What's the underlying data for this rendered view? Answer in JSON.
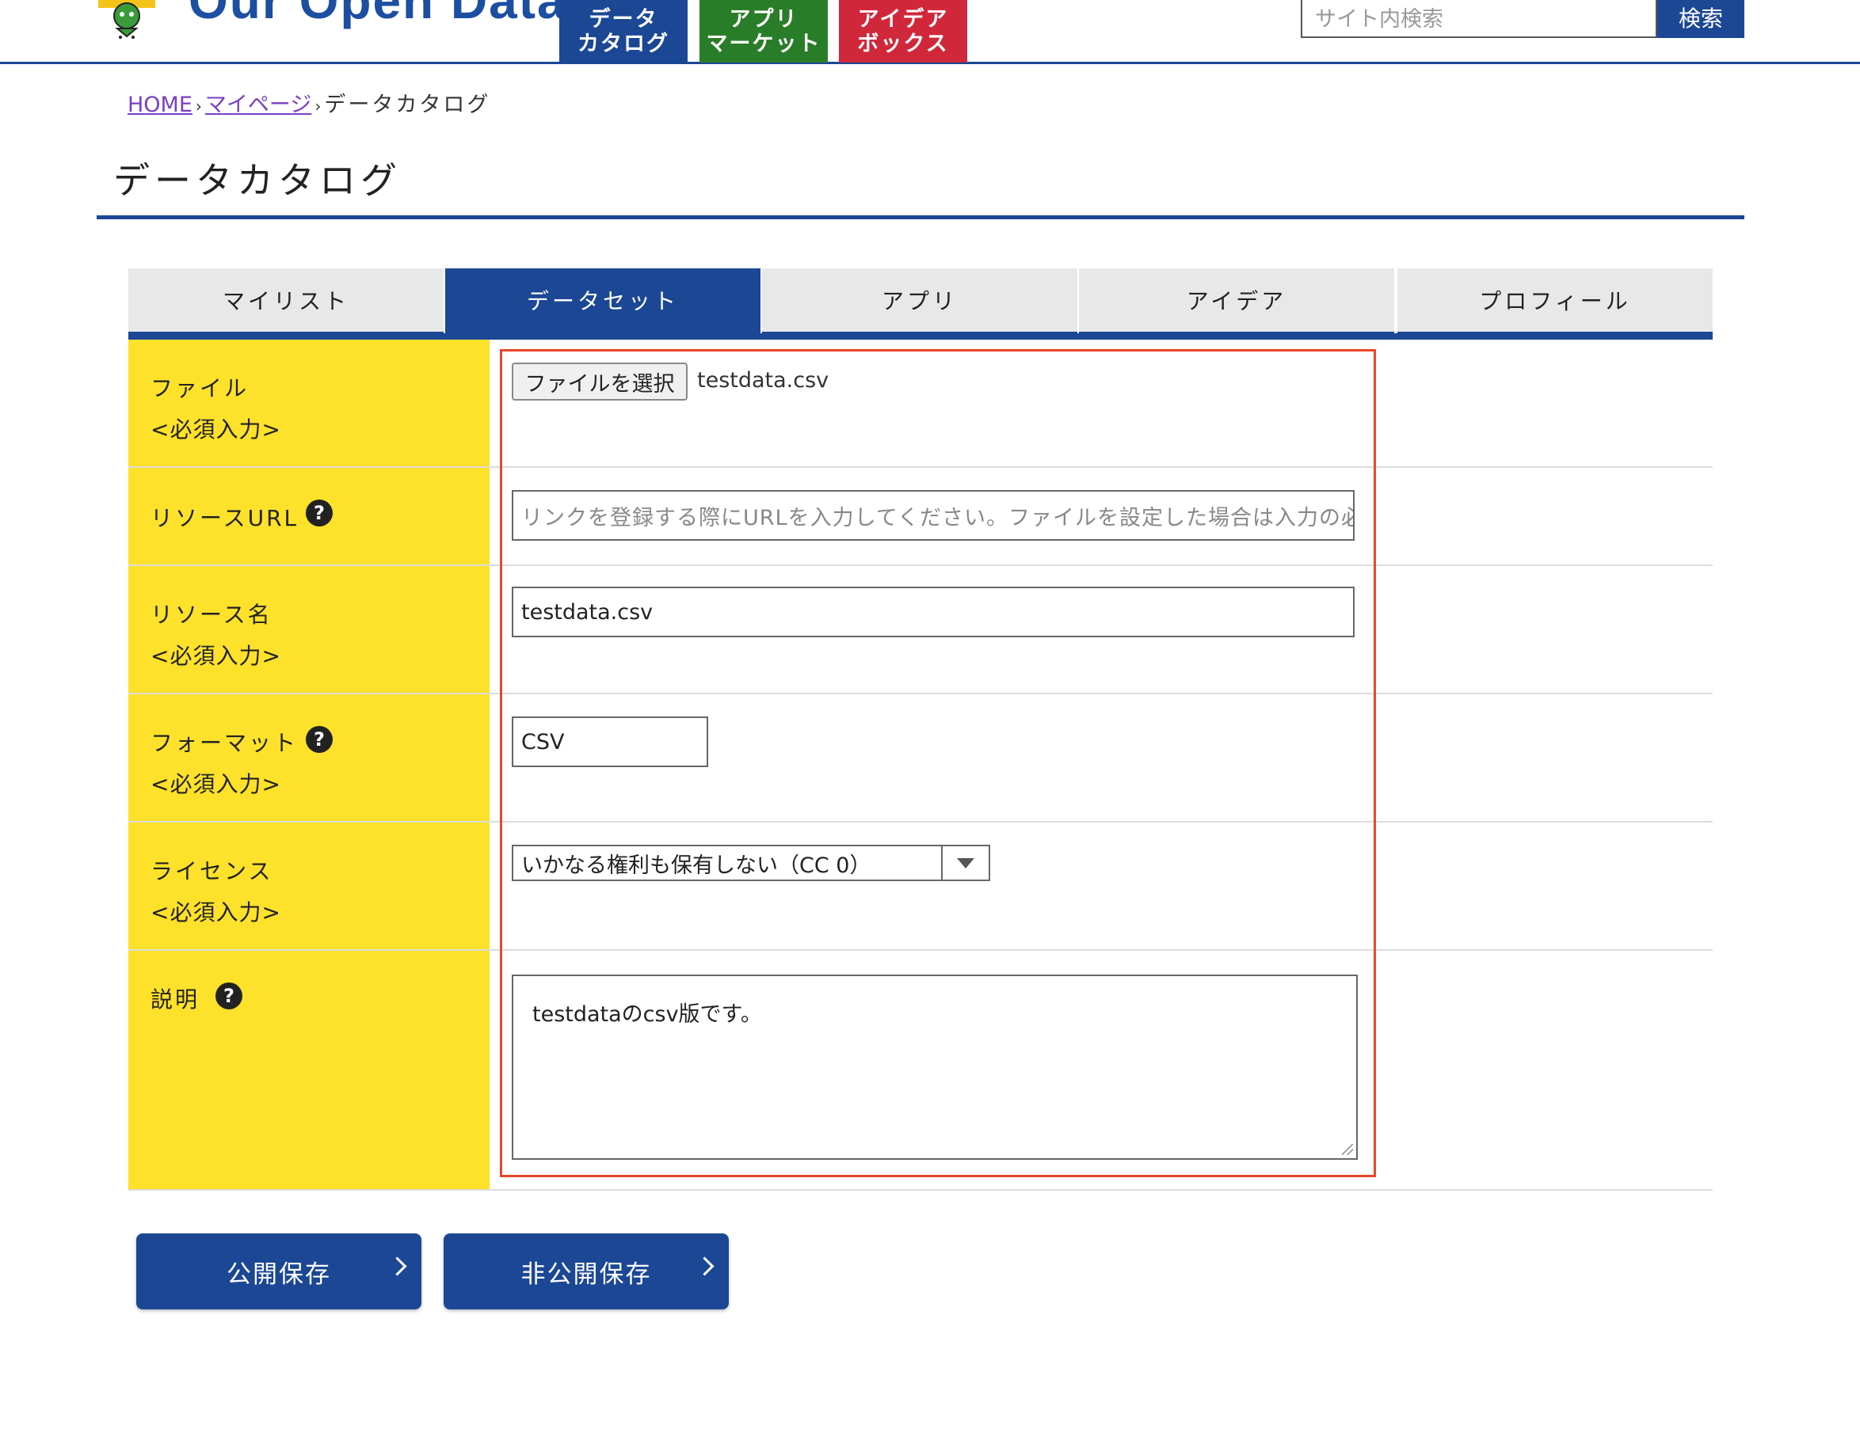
{
  "header": {
    "logo_text": "Our Open Data",
    "nav": [
      {
        "line1": "データ",
        "line2": "カタログ"
      },
      {
        "line1": "アプリ",
        "line2": "マーケット"
      },
      {
        "line1": "アイデア",
        "line2": "ボックス"
      }
    ],
    "search_placeholder": "サイト内検索",
    "search_button": "検索"
  },
  "breadcrumb": {
    "home": "HOME",
    "mypage": "マイページ",
    "current": "データカタログ",
    "separator": "›"
  },
  "page_title": "データカタログ",
  "tabs": [
    {
      "label": "マイリスト",
      "active": false
    },
    {
      "label": "データセット",
      "active": true
    },
    {
      "label": "アプリ",
      "active": false
    },
    {
      "label": "アイデア",
      "active": false
    },
    {
      "label": "プロフィール",
      "active": false
    }
  ],
  "form": {
    "required_mark": "<必須入力>",
    "help_glyph": "?",
    "file": {
      "label": "ファイル",
      "button": "ファイルを選択",
      "filename": "testdata.csv"
    },
    "resource_url": {
      "label": "リソースURL",
      "placeholder": "リンクを登録する際にURLを入力してください。ファイルを設定した場合は入力の必"
    },
    "resource_name": {
      "label": "リソース名",
      "value": "testdata.csv"
    },
    "format": {
      "label": "フォーマット",
      "value": "CSV"
    },
    "license": {
      "label": "ライセンス",
      "selected": "いかなる権利も保有しない（CC 0）"
    },
    "description": {
      "label": "説明",
      "value": "testdataのcsv版です。"
    }
  },
  "actions": {
    "public_save": "公開保存",
    "private_save": "非公開保存"
  },
  "colors": {
    "primary": "#1c4795",
    "label_bg": "#fde12a",
    "nav_green": "#2a7d28",
    "nav_red": "#d0283a",
    "highlight": "#e8462a"
  }
}
